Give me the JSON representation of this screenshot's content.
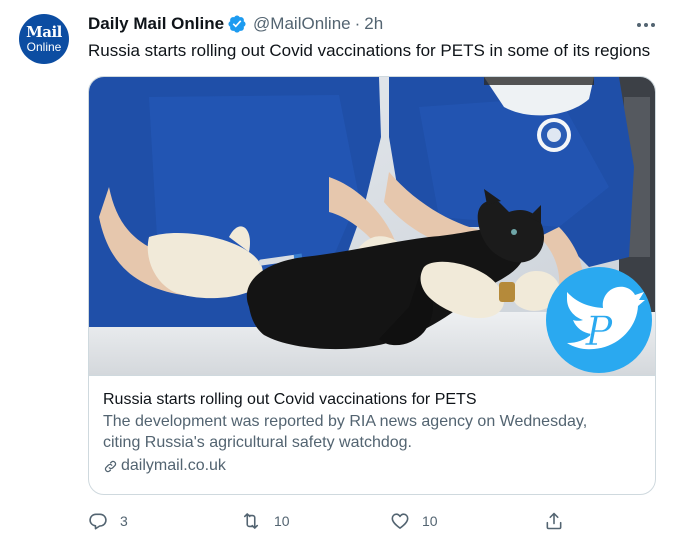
{
  "account": {
    "avatar_line1": "Mail",
    "avatar_line2": "Online",
    "name": "Daily Mail Online",
    "verified": true,
    "handle": "@MailOnline",
    "separator": "·",
    "time": "2h"
  },
  "tweet": {
    "text": "Russia starts rolling out Covid vaccinations for PETS in some of its regions"
  },
  "card": {
    "image_alt_subject": "cat being vaccinated by two people in blue scrubs",
    "title": "Russia starts rolling out Covid vaccinations for PETS",
    "description": "The development was reported by RIA news agency on Wednesday, citing Russia's agricultural safety watchdog.",
    "domain": "dailymail.co.uk"
  },
  "actions": {
    "reply_count": "3",
    "retweet_count": "10",
    "like_count": "10"
  },
  "icons": {
    "verified": "verified-badge-icon",
    "more": "more-options-icon",
    "link": "link-icon",
    "reply": "reply-icon",
    "retweet": "retweet-icon",
    "like": "heart-icon",
    "share": "share-icon"
  },
  "colors": {
    "brand_blue": "#0c4da2",
    "verified_blue": "#1d9bf0",
    "secondary_text": "#536471",
    "primary_text": "#0f1419",
    "border": "#cfd9de",
    "scrubs_blue": "#1f4fa8",
    "watermark_blue": "#2aa9f0"
  }
}
